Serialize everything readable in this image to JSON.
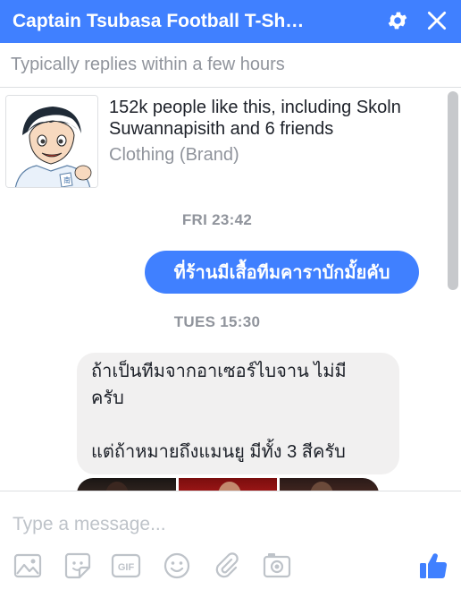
{
  "header": {
    "title": "Captain Tsubasa Football T-Sh…",
    "icons": [
      "gear-icon",
      "close-icon"
    ],
    "background": "#4080ff"
  },
  "subheader": {
    "text": "Typically replies within a few hours"
  },
  "page_card": {
    "likes_text": "152k people like this, including Skoln Suwannapisith and 6 friends",
    "category": "Clothing (Brand)"
  },
  "messages": [
    {
      "timestamp": "FRI 23:42"
    },
    {
      "outgoing_text": "ที่ร้านมีเสื้อทีมคาราบักมั้ยคับ"
    },
    {
      "timestamp": "TUES 15:30"
    },
    {
      "incoming_lines": [
        "ถ้าเป็นทีมจากอาเซอร์ไบจาน ไม่มี",
        "ครับ",
        "",
        "แต่ถ้าหมายถึงแมนยู มีทั้ง 3 สีครับ"
      ]
    }
  ],
  "composer": {
    "placeholder": "Type a message...",
    "value": "",
    "tools": [
      "image-icon",
      "sticker-icon",
      "gif-icon",
      "emoji-icon",
      "attachment-icon",
      "camera-icon",
      "like-icon"
    ],
    "gif_label": "GIF"
  },
  "colors": {
    "accent": "#4080ff",
    "incoming_bubble": "#f1f0f0",
    "muted_text": "#90949c",
    "toolbar_icon": "#bec3c9"
  }
}
